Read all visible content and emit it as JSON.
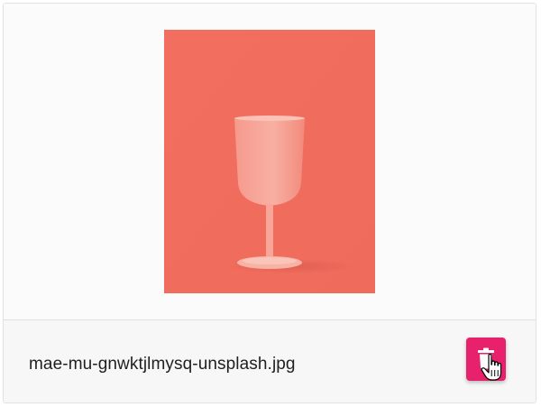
{
  "file_card": {
    "file_name": "mae-mu-gnwktjlmysq-unsplash.jpg",
    "preview_icon": "image-preview",
    "delete_icon": "trash-icon",
    "cursor_icon": "hand-pointer-icon"
  },
  "colors": {
    "preview_background": "#f0705f",
    "delete_button": "#e8216d",
    "text": "#1f1f1f"
  }
}
